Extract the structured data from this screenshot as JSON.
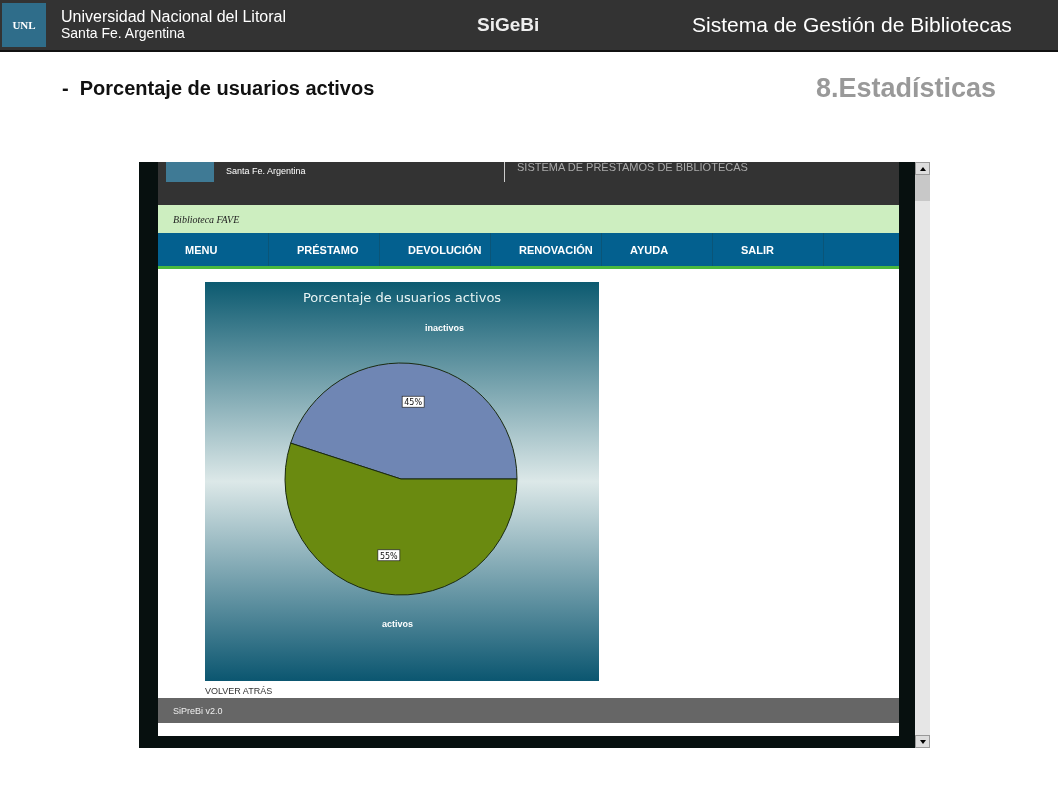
{
  "slide": {
    "logo_text": "UNL",
    "org_name": "Universidad Nacional del Litoral",
    "org_location": "Santa Fe. Argentina",
    "app_name": "SiGeBi",
    "app_title": "Sistema de Gestión de Bibliotecas",
    "bullet": "-",
    "heading": "Porcentaje de usuarios activos",
    "section": "8.Estadísticas"
  },
  "browser": {
    "header": {
      "location": "Santa Fe. Argentina",
      "system_title": "SISTEMA DE PRÉSTAMOS DE BIBLIOTECAS"
    },
    "library": "Biblioteca FAVE",
    "nav": [
      "MENU",
      "PRÉSTAMO",
      "DEVOLUCIÓN",
      "RENOVACIÓN",
      "AYUDA",
      "SALIR"
    ],
    "chart_data": {
      "type": "pie",
      "title": "Porcentaje de usuarios activos",
      "categories": [
        "inactivos",
        "activos"
      ],
      "series": [
        {
          "values": [
            45,
            55
          ]
        }
      ],
      "value_labels": [
        "45%",
        "55%"
      ]
    },
    "back_link": "VOLVER ATRÁS",
    "footer": "SiPreBi v2.0"
  }
}
